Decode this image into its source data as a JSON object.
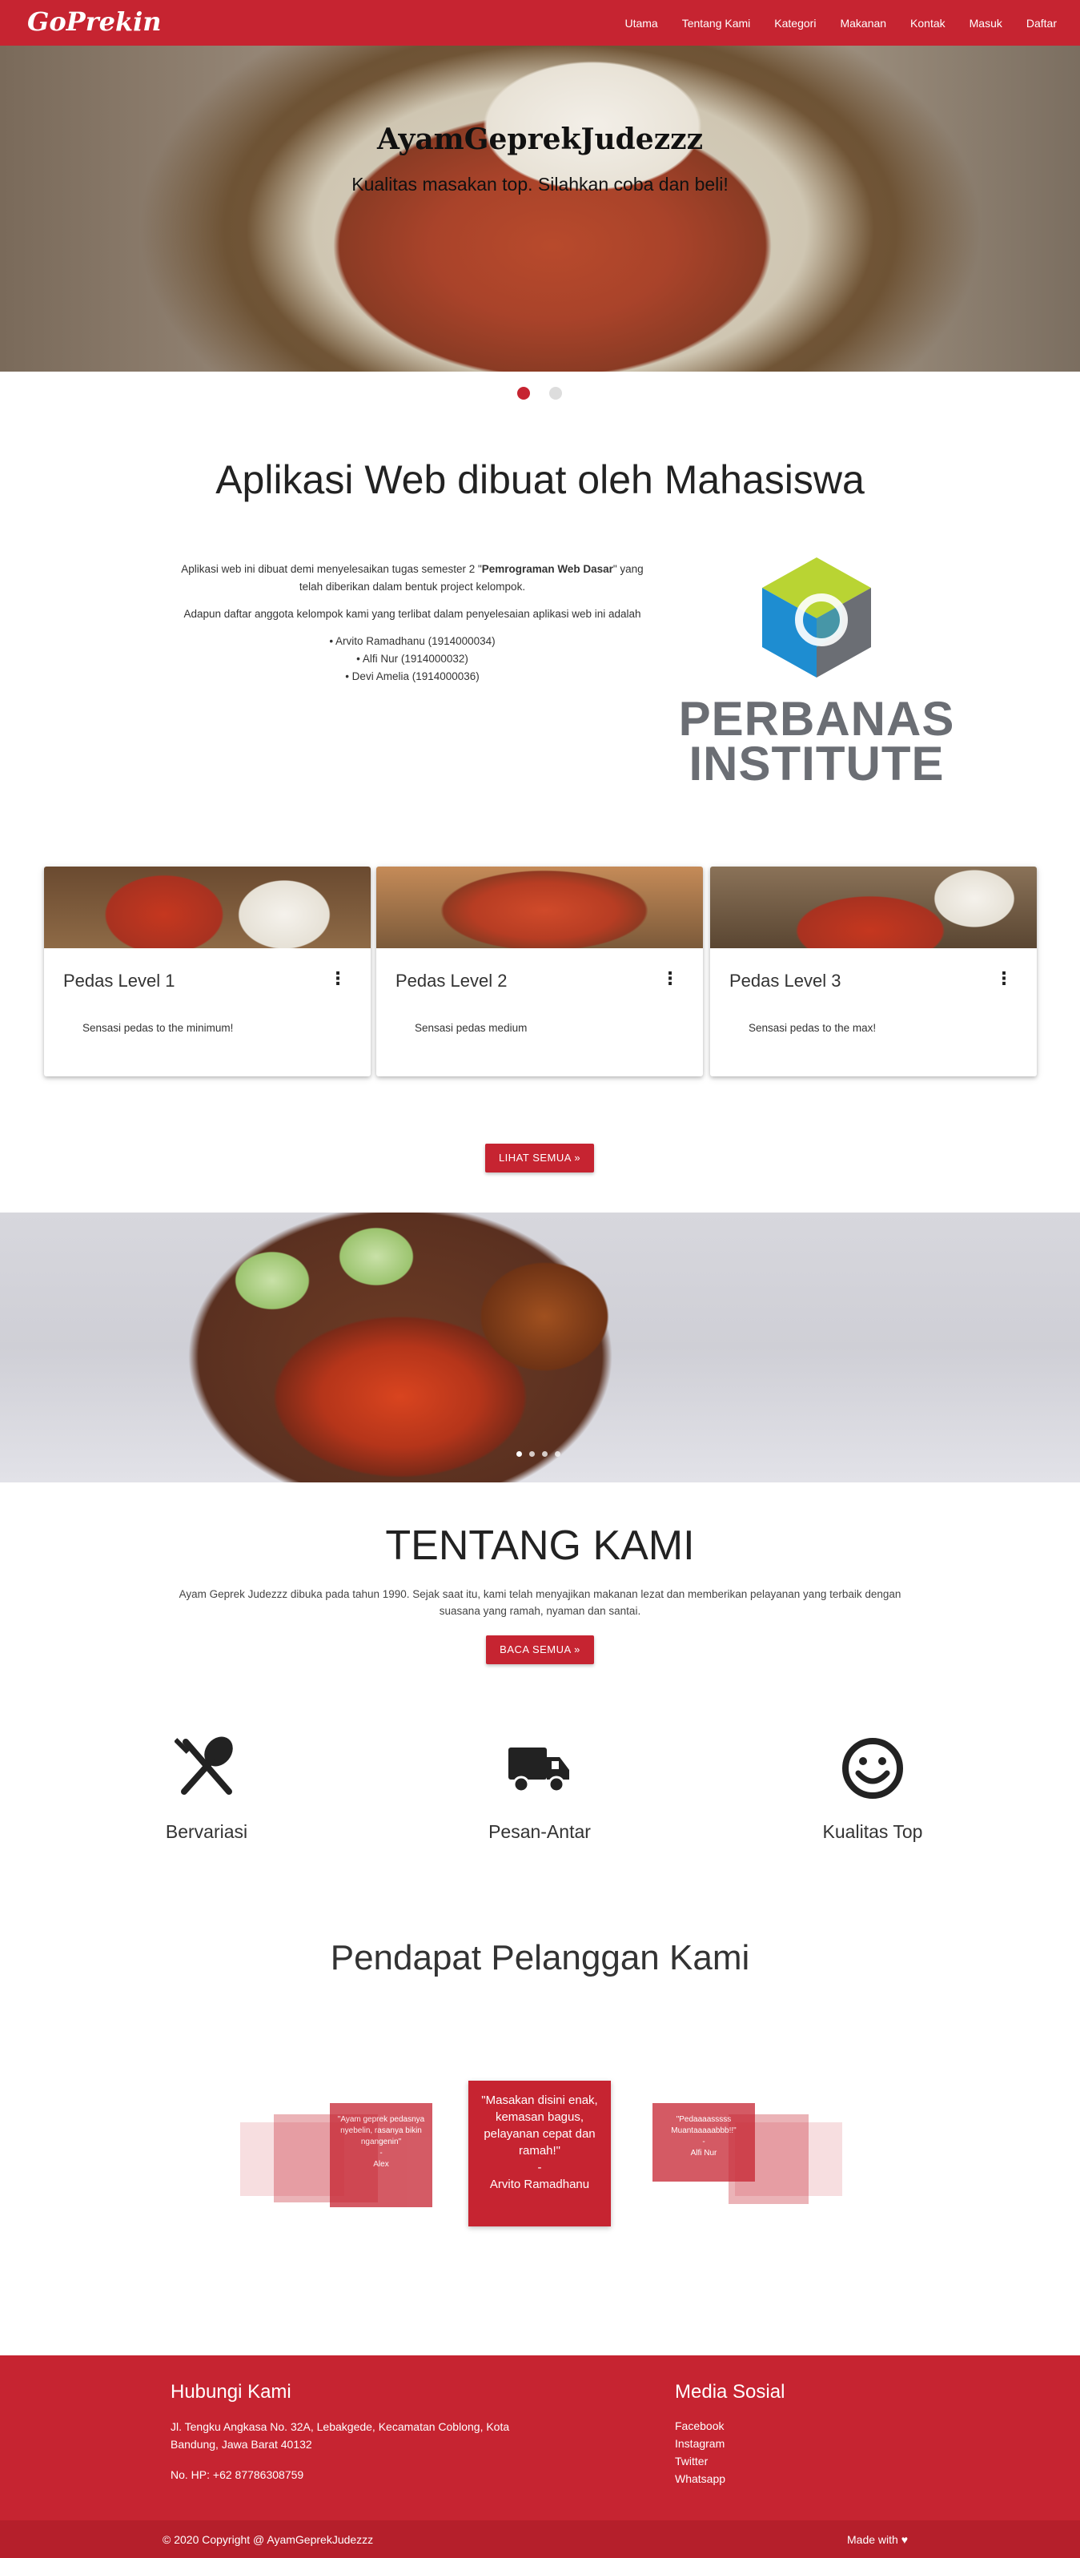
{
  "navbar": {
    "brand": "GoPrekin",
    "links": [
      "Utama",
      "Tentang Kami",
      "Kategori",
      "Makanan",
      "Kontak",
      "Masuk",
      "Daftar"
    ]
  },
  "hero": {
    "title": "AyamGeprekJudezzz",
    "subtitle": "Kualitas masakan top. Silahkan coba dan beli!",
    "slides_total": 2,
    "slide_active": 1
  },
  "about": {
    "title": "Aplikasi Web dibuat oleh Mahasiswa",
    "p1_a": "Aplikasi web ini dibuat demi menyelesaikan tugas semester 2 \"",
    "p1_bold": "Pemrograman Web Dasar",
    "p1_b": "\" yang telah diberikan dalam bentuk project kelompok.",
    "p2": "Adapun daftar anggota kelompok kami yang terlibat dalam penyelesaian aplikasi web ini adalah",
    "members": [
      "• Arvito Ramadhanu (1914000034)",
      "• Alfi Nur (1914000032)",
      "• Devi Amelia (1914000036)"
    ],
    "logo_line1": "PERBANAS",
    "logo_line2": "INSTITUTE"
  },
  "cards": [
    {
      "title": "Pedas Level 1",
      "desc": "Sensasi pedas to the minimum!"
    },
    {
      "title": "Pedas Level 2",
      "desc": "Sensasi pedas medium"
    },
    {
      "title": "Pedas Level 3",
      "desc": "Sensasi pedas to the max!"
    }
  ],
  "cards_button": "LIHAT SEMUA »",
  "parallax": {
    "slides_total": 4,
    "slide_active": 1
  },
  "tentang": {
    "title": "TENTANG KAMI",
    "text": "Ayam Geprek Judezzz dibuka pada tahun 1990. Sejak saat itu, kami telah menyajikan makanan lezat dan memberikan pelayanan yang terbaik dengan suasana yang ramah, nyaman dan santai.",
    "button": "BACA SEMUA »"
  },
  "features": [
    {
      "icon": "utensils-icon",
      "label": "Bervariasi"
    },
    {
      "icon": "truck-icon",
      "label": "Pesan-Antar"
    },
    {
      "icon": "smile-icon",
      "label": "Kualitas Top"
    }
  ],
  "testimonials": {
    "title": "Pendapat Pelanggan Kami",
    "center": {
      "quote": "\"Masakan disini enak, kemasan bagus, pelayanan cepat dan ramah!\"",
      "dash": "-",
      "name": "Arvito Ramadhanu"
    },
    "left": {
      "quote": "\"Ayam geprek pedasnya nyebelin, rasanya bikin ngangenin\"",
      "dash": "-",
      "name": "Alex"
    },
    "right": {
      "quote": "\"Pedaaaasssss Muantaaaaabbb!!\"",
      "dash": "-",
      "name": "Alfi Nur"
    }
  },
  "footer": {
    "contact_title": "Hubungi Kami",
    "address": "Jl. Tengku Angkasa No. 32A, Lebakgede, Kecamatan Coblong, Kota Bandung, Jawa Barat 40132",
    "phone": "No. HP: +62 87786308759",
    "social_title": "Media Sosial",
    "social_links": [
      "Facebook",
      "Instagram",
      "Twitter",
      "Whatsapp"
    ],
    "copyright": "© 2020 Copyright @ AyamGeprekJudezzz",
    "made_with": "Made with"
  },
  "colors": {
    "primary": "#c62431",
    "footer_bottom": "#b51f2b"
  }
}
